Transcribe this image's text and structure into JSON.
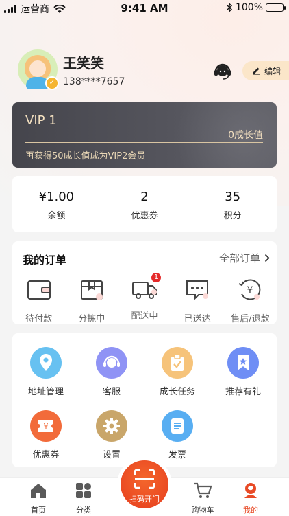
{
  "status_bar": {
    "carrier": "运营商",
    "time": "9:41 AM",
    "battery": "100%"
  },
  "profile": {
    "name": "王笑笑",
    "phone": "138****7657"
  },
  "header": {
    "edit_label": "编辑"
  },
  "vip": {
    "level": "VIP 1",
    "growth": "0成长值",
    "tip": "再获得50成长值成为VIP2会员"
  },
  "stats": [
    {
      "value": "¥1.00",
      "label": "余额"
    },
    {
      "value": "2",
      "label": "优惠券"
    },
    {
      "value": "35",
      "label": "积分"
    }
  ],
  "orders": {
    "title": "我的订单",
    "all_label": "全部订单",
    "items": [
      {
        "label": "待付款",
        "icon": "wallet-icon"
      },
      {
        "label": "分拣中",
        "icon": "box-icon"
      },
      {
        "label": "配送中",
        "icon": "truck-icon",
        "badge": "1"
      },
      {
        "label": "已送达",
        "icon": "message-icon"
      },
      {
        "label": "售后/退款",
        "icon": "refund-icon"
      }
    ]
  },
  "services": [
    {
      "label": "地址管理",
      "icon": "location-icon",
      "color": "#67c1f1"
    },
    {
      "label": "客服",
      "icon": "headset-icon",
      "color": "#8f93f5"
    },
    {
      "label": "成长任务",
      "icon": "clipboard-icon",
      "color": "#f6c37a"
    },
    {
      "label": "推荐有礼",
      "icon": "star-bookmark-icon",
      "color": "#6f8ef5"
    },
    {
      "label": "优惠券",
      "icon": "coupon-icon",
      "color": "#f26b3a"
    },
    {
      "label": "设置",
      "icon": "gear-icon",
      "color": "#c9a66a"
    },
    {
      "label": "发票",
      "icon": "invoice-icon",
      "color": "#58aef2"
    }
  ],
  "tabbar": {
    "home": "首页",
    "category": "分类",
    "scan": "扫码开门",
    "cart": "购物车",
    "mine": "我的"
  },
  "colors": {
    "accent": "#e84a26",
    "vip_gold": "#f3e0c0",
    "badge_red": "#e52a2a"
  }
}
